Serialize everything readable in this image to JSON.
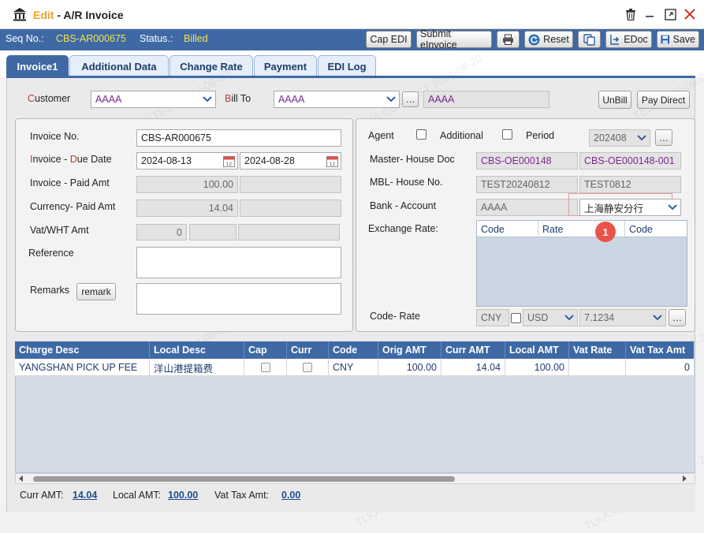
{
  "window": {
    "title_mode": "Edit",
    "title_sep": " - ",
    "title_name": "A/R Invoice"
  },
  "toolbar": {
    "seq_label": "Seq No.:",
    "seq_value": "CBS-AR000675",
    "status_label": "Status.:",
    "status_value": "Billed",
    "cap_edi": "Cap EDI",
    "submit_einvoice": "Submit eInvoice",
    "reset": "Reset",
    "edoc": "EDoc",
    "save": "Save"
  },
  "tabs": [
    "Invoice1",
    "Additional Data",
    "Change Rate",
    "Payment",
    "EDI Log"
  ],
  "header": {
    "customer_label_first": "C",
    "customer_label_rest": "ustomer",
    "customer_value": "AAAA",
    "billto_label_first": "B",
    "billto_label_rest": "ill To",
    "billto_value": "AAAA",
    "billto_name": "AAAA",
    "unbill": "UnBill",
    "pay_direct": "Pay Direct"
  },
  "left": {
    "invoice_no_label": "Invoice No.",
    "invoice_no": "CBS-AR000675",
    "invoice_due_label_i": "I",
    "invoice_due_label_mid": "nvoice - ",
    "invoice_due_label_d": "D",
    "invoice_due_label_rest": "ue Date",
    "invoice_date": "2024-08-13",
    "due_date": "2024-08-28",
    "invoice_paid_label": "Invoice - Paid Amt",
    "invoice_amt": "100.00",
    "currency_paid_label": "Currency- Paid Amt",
    "currency_amt": "14.04",
    "vat_label": "Vat/WHT Amt",
    "vat_value": "0",
    "reference_label": "Reference",
    "remarks_label": "Remarks",
    "remark_button": "remark"
  },
  "right": {
    "agent_label": "Agent",
    "additional_label": "Additional",
    "period_label": "Period",
    "period_value": "202408",
    "master_house_label": "Master- House Doc",
    "master_doc": "CBS-OE000148",
    "house_doc": "CBS-OE000148-001",
    "mbl_house_label": "MBL- House No.",
    "mbl_no": "TEST20240812",
    "house_no": "TEST0812",
    "bank_label": "Bank -  Account",
    "bank_value": "AAAA",
    "account_value": "上海静安分行",
    "exchange_label": "Exchange Rate:",
    "exchange_headers": [
      "Code",
      "Rate",
      "Code"
    ],
    "badge": "1",
    "code_rate_label": "Code- Rate",
    "code_value": "CNY",
    "rate_currency": "USD",
    "rate_value": "7.1234"
  },
  "grid": {
    "headers": [
      "Charge Desc",
      "Local Desc",
      "Cap",
      "Curr",
      "Code",
      "Orig AMT",
      "Curr AMT",
      "Local AMT",
      "Vat Rate",
      "Vat Tax Amt"
    ],
    "rows": [
      {
        "charge_desc": "YANGSHAN PICK UP FEE",
        "local_desc": "洋山港提箱费",
        "code": "CNY",
        "orig_amt": "100.00",
        "curr_amt": "14.04",
        "local_amt": "100.00",
        "vat_rate": "",
        "vat_tax_amt": "0"
      }
    ]
  },
  "footer": {
    "curr_amt_label": "Curr AMT:",
    "curr_amt": "14.04",
    "local_amt_label": "Local AMT:",
    "local_amt": "100.00",
    "vat_label": "Vat Tax Amt:",
    "vat_amt": "0.00"
  },
  "watermark_text": "TLKA.CBS.TEST 2024-08-20",
  "colors": {
    "toolbar_bg": "#3e69a5",
    "status_yellow": "#f4e34a",
    "title_edit": "#f0a020",
    "required_red": "#c0392b",
    "badge_red": "#e8534a"
  }
}
